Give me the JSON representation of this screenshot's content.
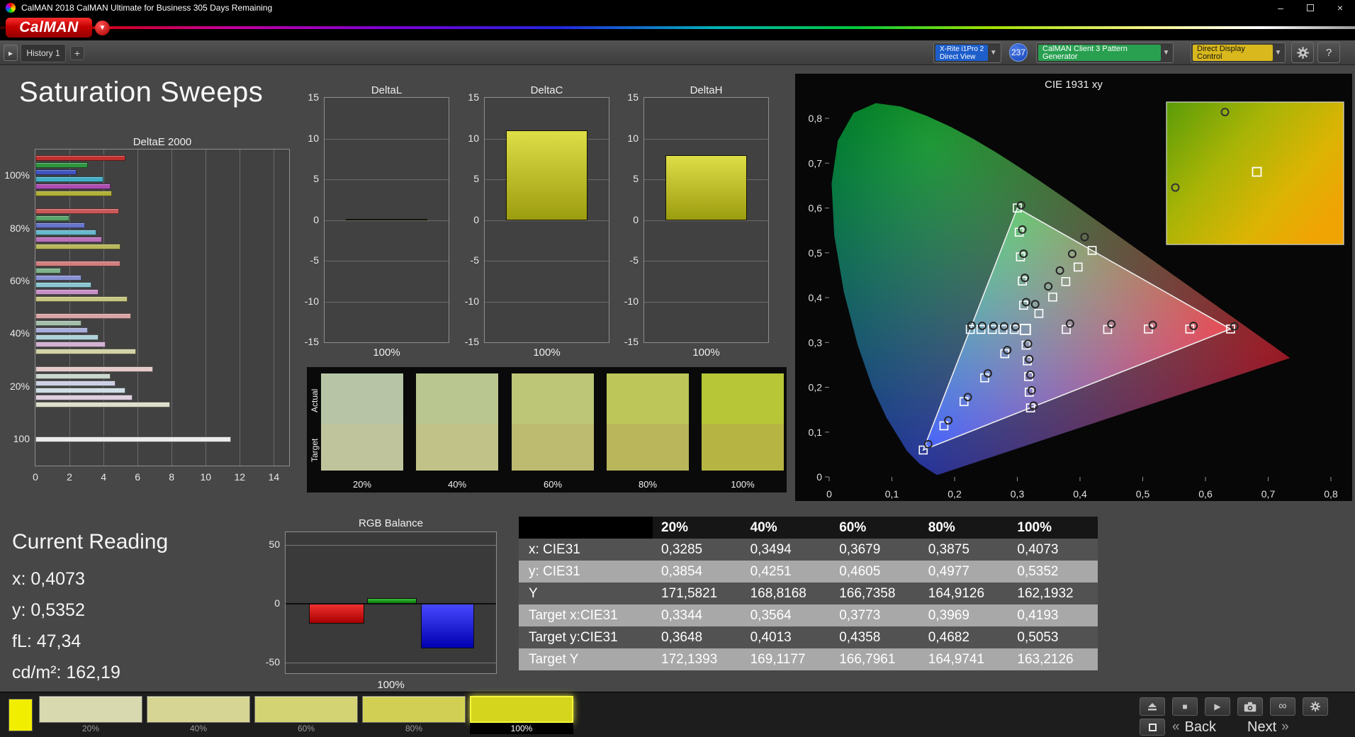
{
  "window": {
    "title": "CalMAN 2018 CalMAN Ultimate for Business 305 Days Remaining",
    "minimize": "–",
    "close": "×"
  },
  "brand": {
    "logo": "CalMAN",
    "chevron": "▼"
  },
  "tabbar": {
    "expand": "▸",
    "history_tab": "History 1",
    "add_tab": "+",
    "meter_line1": "X-Rite i1Pro 2",
    "meter_line2": "Direct View",
    "meter_badge": "237",
    "pattern_label": "CalMAN Client 3 Pattern Generator",
    "display_label": "Direct Display Control",
    "chevron": "▼",
    "help": "?"
  },
  "page_title": "Saturation Sweeps",
  "charts": {
    "deltaE": {
      "title": "DeltaE 2000",
      "xticks": [
        0,
        2,
        4,
        6,
        8,
        10,
        12,
        14
      ],
      "xmax": 14.9,
      "groups": [
        {
          "label": "100%",
          "values": [
            5.3,
            3.1,
            2.4,
            4.0,
            4.4,
            4.5
          ],
          "colors": [
            "#c03030",
            "#2f9640",
            "#4054c0",
            "#40aec4",
            "#ae4cb2",
            "#b0b038"
          ]
        },
        {
          "label": "80%",
          "values": [
            4.9,
            2.0,
            2.9,
            3.6,
            3.9,
            5.0
          ],
          "colors": [
            "#ca5858",
            "#58a468",
            "#6474ca",
            "#66b8ca",
            "#ba70ba",
            "#b8b85c"
          ]
        },
        {
          "label": "60%",
          "values": [
            5.0,
            1.5,
            2.7,
            3.3,
            3.7,
            5.4
          ],
          "colors": [
            "#d27e7e",
            "#7eb28a",
            "#8892d2",
            "#8ac6d2",
            "#c690c6",
            "#c6c682"
          ]
        },
        {
          "label": "40%",
          "values": [
            5.6,
            2.7,
            3.1,
            3.7,
            4.1,
            5.9
          ],
          "colors": [
            "#daa4a4",
            "#a4c0ac",
            "#a8aeda",
            "#aed2da",
            "#d2b0d2",
            "#d2d2a6"
          ]
        },
        {
          "label": "20%",
          "values": [
            6.9,
            4.4,
            4.7,
            5.3,
            5.7,
            7.9
          ],
          "colors": [
            "#e4caca",
            "#cad8ce",
            "#ccd0e4",
            "#cedee4",
            "#decede",
            "#dedeca"
          ]
        },
        {
          "label": "100",
          "values": [
            11.5
          ],
          "colors": [
            "#ebebeb"
          ]
        }
      ]
    },
    "delta_axis": {
      "ymin": -15,
      "ymax": 15,
      "ticks": [
        15,
        10,
        5,
        0,
        -5,
        -10,
        -15
      ]
    },
    "deltaL": {
      "title": "DeltaL",
      "xlabel": "100%",
      "value": 0.15
    },
    "deltaC": {
      "title": "DeltaC",
      "xlabel": "100%",
      "value": 11.0
    },
    "deltaH": {
      "title": "DeltaH",
      "xlabel": "100%",
      "value": 8.0
    },
    "rgb": {
      "title": "RGB Balance",
      "xlabel": "100%",
      "yticks": [
        50,
        0,
        -50
      ],
      "ymin": -59,
      "ymax": 61,
      "bars": [
        {
          "name": "red",
          "value": -17,
          "color_top": "#f03030",
          "color_bottom": "#a80000"
        },
        {
          "name": "green",
          "value": 5,
          "color_top": "#38c038",
          "color_bottom": "#087808"
        },
        {
          "name": "blue",
          "value": -38,
          "color_top": "#4848ff",
          "color_bottom": "#0000b0"
        }
      ]
    }
  },
  "swatch_panel": {
    "row_labels": [
      "Actual",
      "Target"
    ],
    "columns": [
      {
        "label": "20%",
        "actual": "#b7c5a6",
        "target": "#c0c49c"
      },
      {
        "label": "40%",
        "actual": "#bac68f",
        "target": "#c1c287"
      },
      {
        "label": "60%",
        "actual": "#bcc676",
        "target": "#bdbb70"
      },
      {
        "label": "80%",
        "actual": "#bcc659",
        "target": "#b9b65c"
      },
      {
        "label": "100%",
        "actual": "#b7c636",
        "target": "#b6b544"
      }
    ]
  },
  "cie": {
    "title": "CIE 1931 xy",
    "xticks": [
      "0",
      "0,1",
      "0,2",
      "0,3",
      "0,4",
      "0,5",
      "0,6",
      "0,7",
      "0,8"
    ],
    "yticks": [
      "0",
      "0,1",
      "0,2",
      "0,3",
      "0,4",
      "0,5",
      "0,6",
      "0,7",
      "0,8"
    ],
    "gamut_triangle": [
      [
        0.64,
        0.33
      ],
      [
        0.3,
        0.6
      ],
      [
        0.15,
        0.06
      ]
    ],
    "white_point": [
      0.3127,
      0.329
    ],
    "target_squares": [
      [
        0.378,
        0.329
      ],
      [
        0.444,
        0.329
      ],
      [
        0.509,
        0.33
      ],
      [
        0.575,
        0.33
      ],
      [
        0.64,
        0.33
      ],
      [
        0.31,
        0.383
      ],
      [
        0.308,
        0.437
      ],
      [
        0.305,
        0.491
      ],
      [
        0.303,
        0.546
      ],
      [
        0.3,
        0.6
      ],
      [
        0.28,
        0.275
      ],
      [
        0.248,
        0.221
      ],
      [
        0.215,
        0.168
      ],
      [
        0.183,
        0.114
      ],
      [
        0.15,
        0.06
      ],
      [
        0.295,
        0.329
      ],
      [
        0.277,
        0.329
      ],
      [
        0.26,
        0.329
      ],
      [
        0.242,
        0.329
      ],
      [
        0.225,
        0.329
      ],
      [
        0.314,
        0.294
      ],
      [
        0.316,
        0.259
      ],
      [
        0.318,
        0.224
      ],
      [
        0.319,
        0.189
      ],
      [
        0.321,
        0.154
      ],
      [
        0.3344,
        0.3648
      ],
      [
        0.3564,
        0.4013
      ],
      [
        0.3773,
        0.4358
      ],
      [
        0.3969,
        0.4682
      ],
      [
        0.4193,
        0.5053
      ]
    ],
    "measured_circles": [
      [
        0.3285,
        0.3854
      ],
      [
        0.3494,
        0.4251
      ],
      [
        0.3679,
        0.4605
      ],
      [
        0.3875,
        0.4977
      ],
      [
        0.4073,
        0.5352
      ],
      [
        0.384,
        0.342
      ],
      [
        0.45,
        0.341
      ],
      [
        0.516,
        0.339
      ],
      [
        0.581,
        0.337
      ],
      [
        0.646,
        0.336
      ],
      [
        0.314,
        0.39
      ],
      [
        0.312,
        0.444
      ],
      [
        0.31,
        0.498
      ],
      [
        0.308,
        0.552
      ],
      [
        0.306,
        0.606
      ],
      [
        0.284,
        0.283
      ],
      [
        0.253,
        0.231
      ],
      [
        0.221,
        0.178
      ],
      [
        0.19,
        0.126
      ],
      [
        0.158,
        0.073
      ],
      [
        0.297,
        0.335
      ],
      [
        0.279,
        0.336
      ],
      [
        0.262,
        0.337
      ],
      [
        0.244,
        0.337
      ],
      [
        0.227,
        0.338
      ],
      [
        0.317,
        0.297
      ],
      [
        0.319,
        0.263
      ],
      [
        0.321,
        0.228
      ],
      [
        0.323,
        0.193
      ],
      [
        0.326,
        0.159
      ]
    ],
    "inset": {
      "circles": [
        [
          0.33,
          0.07
        ],
        [
          0.05,
          0.6
        ]
      ],
      "square": [
        0.51,
        0.49
      ]
    }
  },
  "reading": {
    "title": "Current Reading",
    "lines": [
      "x: 0,4073",
      "y: 0,5352",
      "fL: 47,34",
      "cd/m²: 162,19"
    ]
  },
  "table": {
    "headers": [
      "",
      "20%",
      "40%",
      "60%",
      "80%",
      "100%"
    ],
    "rows": [
      {
        "label": "x: CIE31",
        "values": [
          "0,3285",
          "0,3494",
          "0,3679",
          "0,3875",
          "0,4073"
        ]
      },
      {
        "label": "y: CIE31",
        "values": [
          "0,3854",
          "0,4251",
          "0,4605",
          "0,4977",
          "0,5352"
        ]
      },
      {
        "label": "Y",
        "values": [
          "171,5821",
          "168,8168",
          "166,7358",
          "164,9126",
          "162,1932"
        ]
      },
      {
        "label": "Target x:CIE31",
        "values": [
          "0,3344",
          "0,3564",
          "0,3773",
          "0,3969",
          "0,4193"
        ]
      },
      {
        "label": "Target y:CIE31",
        "values": [
          "0,3648",
          "0,4013",
          "0,4358",
          "0,4682",
          "0,5053"
        ]
      },
      {
        "label": "Target Y",
        "values": [
          "172,1393",
          "169,1177",
          "166,7961",
          "164,9741",
          "163,2126"
        ]
      }
    ]
  },
  "bottom": {
    "chip_color": "#f2ee00",
    "swatches": [
      {
        "label": "20%",
        "color": "#d9d9b0",
        "selected": false
      },
      {
        "label": "40%",
        "color": "#d6d593",
        "selected": false
      },
      {
        "label": "60%",
        "color": "#d3d374",
        "selected": false
      },
      {
        "label": "80%",
        "color": "#d1d054",
        "selected": false
      },
      {
        "label": "100%",
        "color": "#d6d51e",
        "selected": true
      }
    ],
    "back": "Back",
    "next": "Next",
    "chev_left": "«",
    "chev_right": "»"
  }
}
